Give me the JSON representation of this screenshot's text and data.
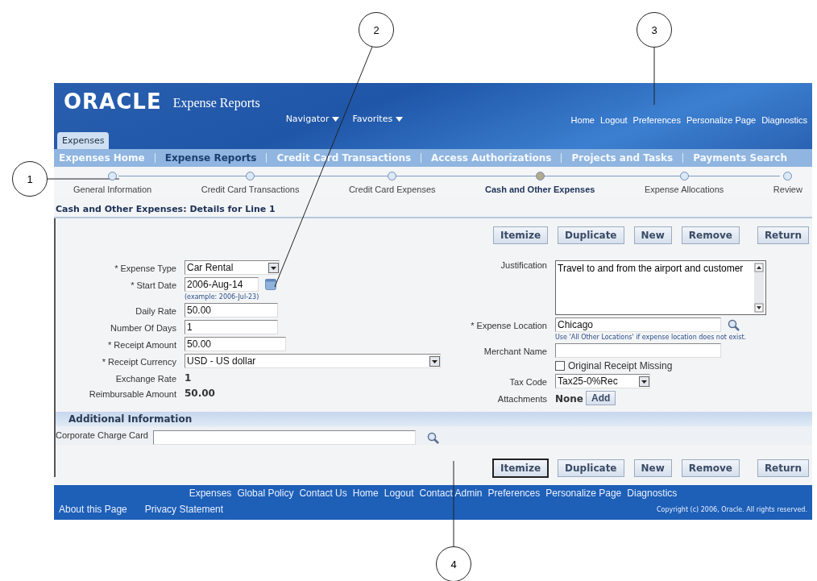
{
  "callouts": [
    {
      "number": "1"
    },
    {
      "number": "2"
    },
    {
      "number": "3"
    },
    {
      "number": "4"
    }
  ],
  "header": {
    "logo": "ORACLE",
    "app_title": "Expense Reports",
    "menus": [
      {
        "label": "Navigator"
      },
      {
        "label": "Favorites"
      }
    ],
    "global_links": [
      "Home",
      "Logout",
      "Preferences",
      "Personalize Page",
      "Diagnostics"
    ]
  },
  "tabs": [
    {
      "label": "Expenses",
      "selected": true
    }
  ],
  "subtabs": [
    {
      "label": "Expenses Home",
      "selected": false
    },
    {
      "label": "Expense Reports",
      "selected": true
    },
    {
      "label": "Credit Card Transactions",
      "selected": false
    },
    {
      "label": "Access Authorizations",
      "selected": false
    },
    {
      "label": "Projects and Tasks",
      "selected": false
    },
    {
      "label": "Payments Search",
      "selected": false
    }
  ],
  "train": [
    {
      "label": "General Information",
      "selected": false
    },
    {
      "label": "Credit Card Transactions",
      "selected": false
    },
    {
      "label": "Credit Card Expenses",
      "selected": false
    },
    {
      "label": "Cash and Other Expenses",
      "selected": true
    },
    {
      "label": "Expense Allocations",
      "selected": false
    },
    {
      "label": "Review",
      "selected": false
    }
  ],
  "section_title": "Cash and Other Expenses: Details for Line 1",
  "buttons": [
    {
      "label": "Itemize",
      "focused": false
    },
    {
      "label": "Duplicate",
      "focused": false
    },
    {
      "label": "New",
      "focused": false
    },
    {
      "label": "Remove",
      "focused": false
    },
    {
      "label": "Return",
      "focused": false
    }
  ],
  "left_fields": [
    {
      "kind": "select",
      "label": "* Expense Type",
      "value": "Car Rental"
    },
    {
      "kind": "date",
      "label": "* Start Date",
      "value": "2006-Aug-14",
      "hint": "(example: 2006-Jul-23)"
    },
    {
      "kind": "text",
      "label": "Daily Rate",
      "value": "50.00"
    },
    {
      "kind": "text",
      "label": "Number Of Days",
      "value": "1"
    },
    {
      "kind": "text",
      "label": "* Receipt Amount",
      "value": "50.00"
    },
    {
      "kind": "wideselect",
      "label": "* Receipt Currency",
      "value": "USD - US dollar"
    },
    {
      "kind": "readonly",
      "label": "Exchange Rate",
      "value": "1"
    },
    {
      "kind": "readonly",
      "label": "Reimbursable Amount",
      "value": "50.00"
    }
  ],
  "right_fields": [
    {
      "kind": "textarea",
      "label": "Justification",
      "value": "Travel to and from the airport and customer"
    },
    {
      "kind": "lov",
      "label": "* Expense Location",
      "value": "Chicago",
      "hint": "Use 'All Other Locations' if expense location does not exist."
    },
    {
      "kind": "text",
      "label": "Merchant Name"
    },
    {
      "kind": "checkbox",
      "label": "Original Receipt Missing",
      "checked": false
    },
    {
      "kind": "select",
      "label": "Tax Code",
      "value": "Tax25-0%Rec"
    },
    {
      "kind": "attachments",
      "label": "Attachments",
      "value": "None",
      "button": "Add"
    }
  ],
  "additional": {
    "title": "Additional Information",
    "field_label": "Corporate Charge Card"
  },
  "bottom_buttons": [
    {
      "label": "Itemize",
      "focused": true
    },
    {
      "label": "Duplicate",
      "focused": false
    },
    {
      "label": "New",
      "focused": false
    },
    {
      "label": "Remove",
      "focused": false
    },
    {
      "label": "Return",
      "focused": false
    }
  ],
  "footer": {
    "links": [
      "Expenses",
      "Global Policy",
      "Contact Us",
      "Home",
      "Logout",
      "Contact Admin",
      "Preferences",
      "Personalize Page",
      "Diagnostics"
    ],
    "bottom_links": [
      "About this Page",
      "Privacy Statement"
    ],
    "copyright": "Copyright (c) 2006, Oracle. All rights reserved."
  }
}
